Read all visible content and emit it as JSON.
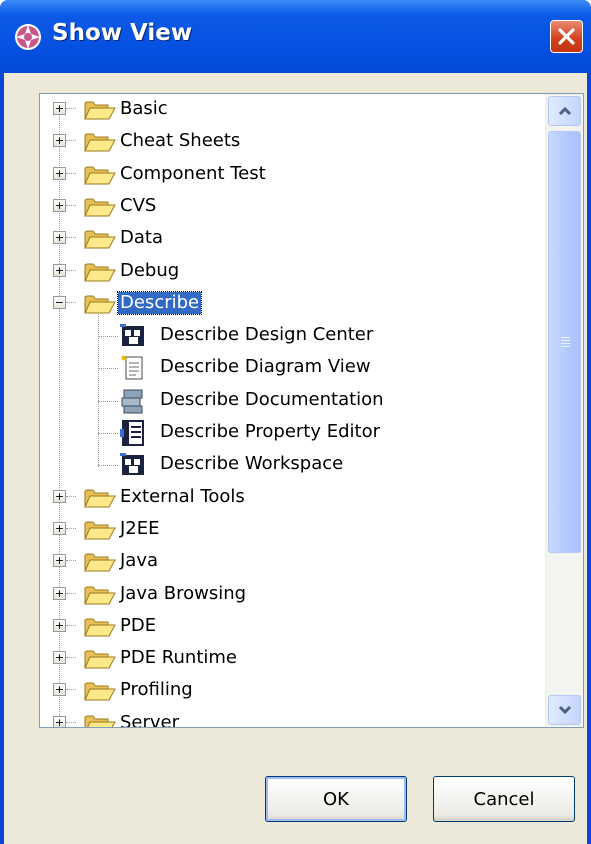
{
  "window": {
    "title": "Show View",
    "icon": "show-view-icon",
    "close_icon": "close-icon"
  },
  "tree": {
    "items": [
      {
        "label": "Basic",
        "expanded": false
      },
      {
        "label": "Cheat Sheets",
        "expanded": false
      },
      {
        "label": "Component Test",
        "expanded": false
      },
      {
        "label": "CVS",
        "expanded": false
      },
      {
        "label": "Data",
        "expanded": false
      },
      {
        "label": "Debug",
        "expanded": false
      },
      {
        "label": "Describe",
        "expanded": true,
        "selected": true,
        "children": [
          {
            "label": "Describe Design Center",
            "icon": "design-center-icon"
          },
          {
            "label": "Describe Diagram View",
            "icon": "diagram-view-icon"
          },
          {
            "label": "Describe Documentation",
            "icon": "documentation-icon"
          },
          {
            "label": "Describe Property Editor",
            "icon": "property-editor-icon"
          },
          {
            "label": "Describe Workspace",
            "icon": "workspace-icon"
          }
        ]
      },
      {
        "label": "External Tools",
        "expanded": false
      },
      {
        "label": "J2EE",
        "expanded": false
      },
      {
        "label": "Java",
        "expanded": false
      },
      {
        "label": "Java Browsing",
        "expanded": false
      },
      {
        "label": "PDE",
        "expanded": false
      },
      {
        "label": "PDE Runtime",
        "expanded": false
      },
      {
        "label": "Profiling",
        "expanded": false
      },
      {
        "label": "Server",
        "expanded": false
      }
    ]
  },
  "buttons": {
    "ok_label": "OK",
    "cancel_label": "Cancel"
  },
  "colors": {
    "titlebar": "#0550e0",
    "selection": "#316ac5",
    "dialog_face": "#ece9d8"
  }
}
